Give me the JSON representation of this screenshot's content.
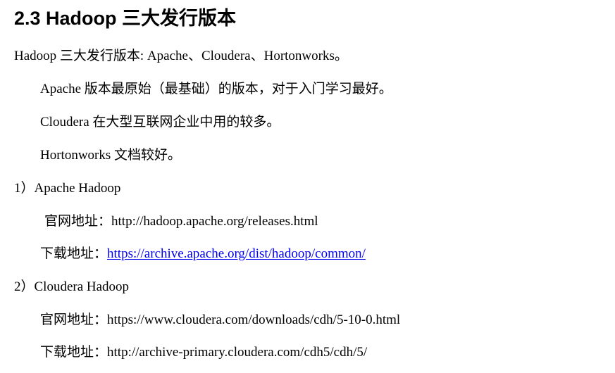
{
  "section": {
    "heading": "2.3 Hadoop 三大发行版本"
  },
  "paragraphs": {
    "intro": "Hadoop  三大发行版本: Apache、Cloudera、Hortonworks。",
    "apache_desc": "Apache 版本最原始（最基础）的版本，对于入门学习最好。",
    "cloudera_desc": "Cloudera 在大型互联网企业中用的较多。",
    "hortonworks_desc": "Hortonworks 文档较好。"
  },
  "apache": {
    "title": "1）Apache Hadoop",
    "site_label": "官网地址：",
    "site_url": "http://hadoop.apache.org/releases.html",
    "download_label": "下载地址：",
    "download_url": "https://archive.apache.org/dist/hadoop/common/"
  },
  "cloudera": {
    "title": "2）Cloudera Hadoop",
    "site_label": "官网地址：",
    "site_url": "https://www.cloudera.com/downloads/cdh/5-10-0.html",
    "download_label": "下载地址：",
    "download_url": "http://archive-primary.cloudera.com/cdh5/cdh/5/"
  },
  "colors": {
    "text": "#000000",
    "link": "#0000ee",
    "background": "#ffffff"
  }
}
